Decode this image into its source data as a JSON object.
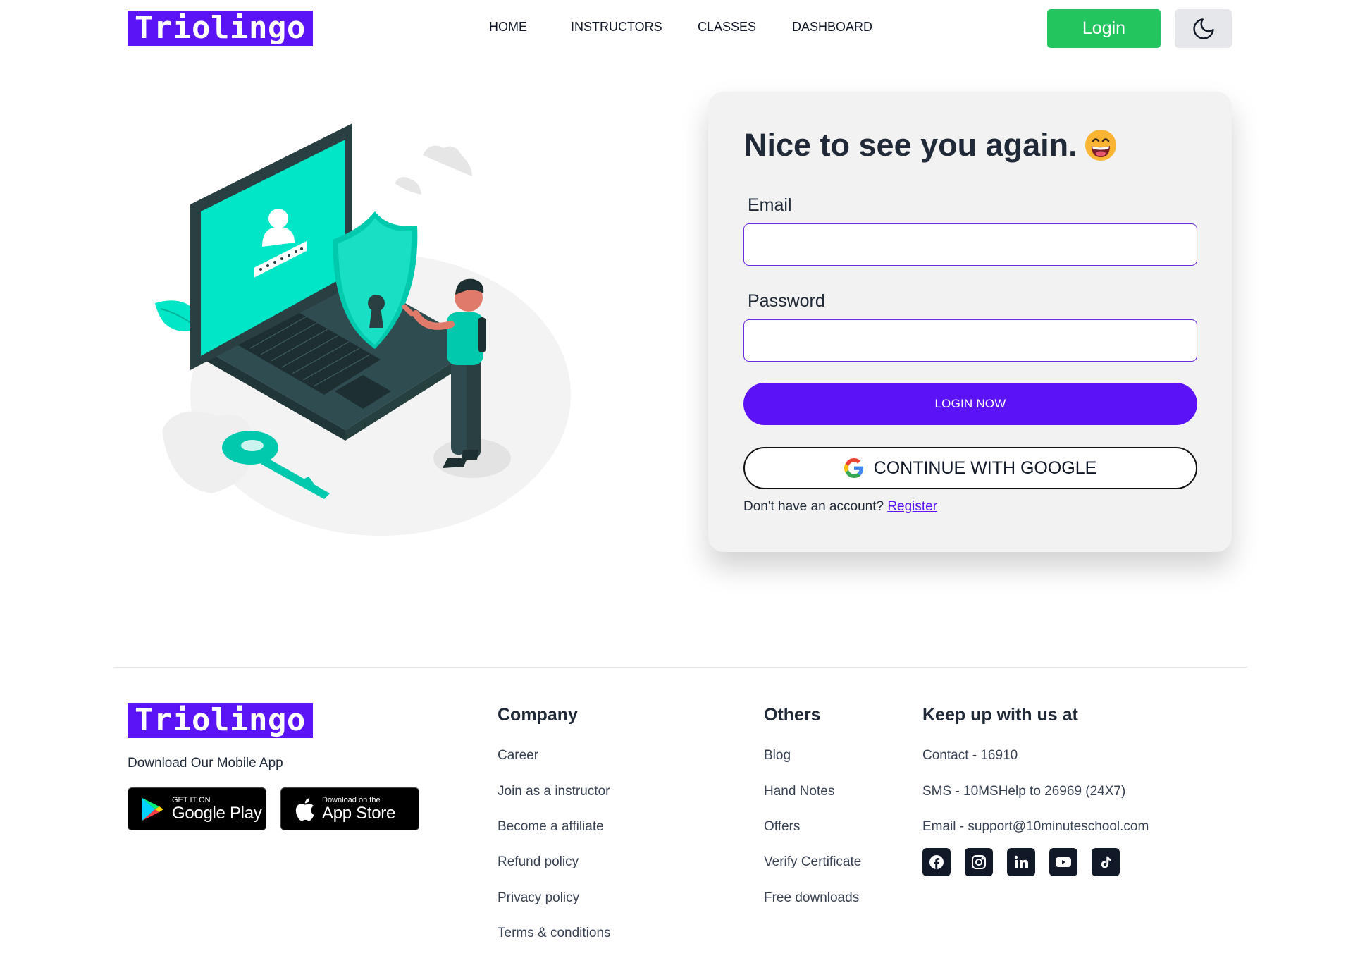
{
  "brand": {
    "name": "Triolingo",
    "color": "#5a14f5"
  },
  "nav": {
    "items": [
      "HOME",
      "INSTRUCTORS",
      "CLASSES",
      "DASHBOARD"
    ]
  },
  "header": {
    "login_label": "Login",
    "theme_icon": "moon-icon"
  },
  "login_card": {
    "title": "Nice to see you again.",
    "emoji": "grinning-face-emoji",
    "email_label": "Email",
    "email_value": "",
    "password_label": "Password",
    "password_value": "",
    "login_button": "LOGIN NOW",
    "google_button": "CONTINUE WITH GOOGLE",
    "no_account_text": "Don't have an account?",
    "register_link": "Register"
  },
  "footer": {
    "download_text": "Download Our Mobile App",
    "google_play": {
      "small": "GET IT ON",
      "big": "Google Play"
    },
    "app_store": {
      "small": "Download on the",
      "big": "App Store"
    },
    "company": {
      "title": "Company",
      "links": [
        "Career",
        "Join as a instructor",
        "Become a affiliate",
        "Refund policy",
        "Privacy policy",
        "Terms & conditions"
      ]
    },
    "others": {
      "title": "Others",
      "links": [
        "Blog",
        "Hand Notes",
        "Offers",
        "Verify Certificate",
        "Free downloads"
      ]
    },
    "contact": {
      "title": "Keep up with us at",
      "lines": [
        "Contact - 16910",
        "SMS - 10MSHelp to 26969 (24X7)",
        "Email - support@10minuteschool.com"
      ],
      "socials": [
        "facebook-icon",
        "instagram-icon",
        "linkedin-icon",
        "youtube-icon",
        "tiktok-icon"
      ]
    }
  },
  "colors": {
    "accent": "#5b12f7",
    "login_green": "#22c55e",
    "illustration_teal": "#00e6c7",
    "dark": "#111827"
  }
}
